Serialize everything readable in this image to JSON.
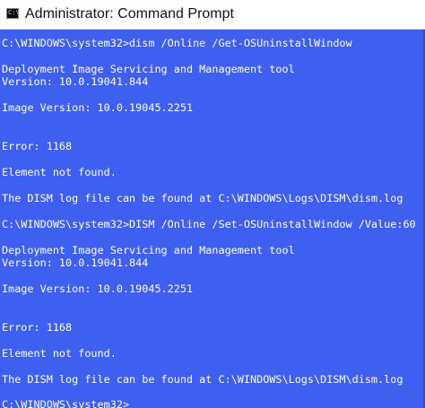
{
  "window": {
    "title": "Administrator: Command Prompt",
    "icon_name": "cmd-icon",
    "icon_glyph": "C:\\"
  },
  "colors": {
    "console_background": "#3f5ff0",
    "console_text": "#ffffff",
    "titlebar_background": "#ffffff"
  },
  "console": {
    "lines": [
      "C:\\WINDOWS\\system32>dism /Online /Get-OSUninstallWindow",
      "Deployment Image Servicing and Management tool",
      "Version: 10.0.19041.844",
      "Image Version: 10.0.19045.2251",
      "Error: 1168",
      "Element not found.",
      "The DISM log file can be found at C:\\WINDOWS\\Logs\\DISM\\dism.log",
      "C:\\WINDOWS\\system32>DISM /Online /Set-OSUninstallWindow /Value:60",
      "Deployment Image Servicing and Management tool",
      "Version: 10.0.19041.844",
      "Image Version: 10.0.19045.2251",
      "Error: 1168",
      "Element not found.",
      "The DISM log file can be found at C:\\WINDOWS\\Logs\\DISM\\dism.log",
      "C:\\WINDOWS\\system32>"
    ]
  }
}
